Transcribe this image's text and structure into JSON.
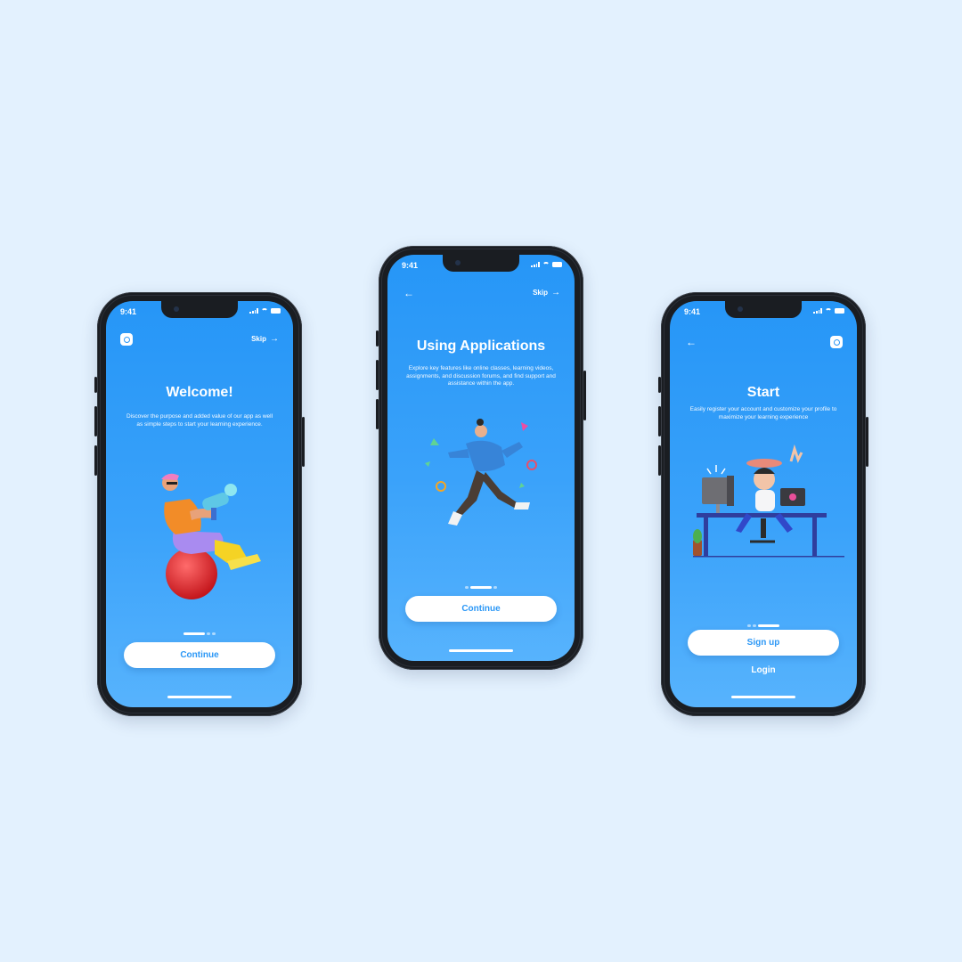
{
  "colors": {
    "background": "#E3F1FE",
    "screen": "#2B97F6",
    "button_text": "#2B97F6",
    "phone": "#1A1D22"
  },
  "screens": [
    {
      "time": "9:41",
      "top_left_icon": "app-logo-icon",
      "skip_label": "Skip",
      "title": "Welcome!",
      "description": "Discover the purpose and added value of our app as well as simple steps to start your learning experience.",
      "page_indicator": {
        "total": 3,
        "active": 1
      },
      "primary_button": "Continue"
    },
    {
      "time": "9:41",
      "top_left_icon": "back-arrow-icon",
      "skip_label": "Skip",
      "title": "Using Applications",
      "description": "Explore key features like online classes, learning videos, assignments, and discussion forums, and find support and assistance within the app.",
      "page_indicator": {
        "total": 3,
        "active": 2
      },
      "primary_button": "Continue"
    },
    {
      "time": "9:41",
      "top_left_icon": "back-arrow-icon",
      "top_right_icon": "app-logo-icon",
      "title": "Start",
      "description": "Easily register your account and customize your profile to maximize your learning experience",
      "page_indicator": {
        "total": 3,
        "active": 3
      },
      "primary_button": "Sign up",
      "secondary_link": "Login"
    }
  ]
}
